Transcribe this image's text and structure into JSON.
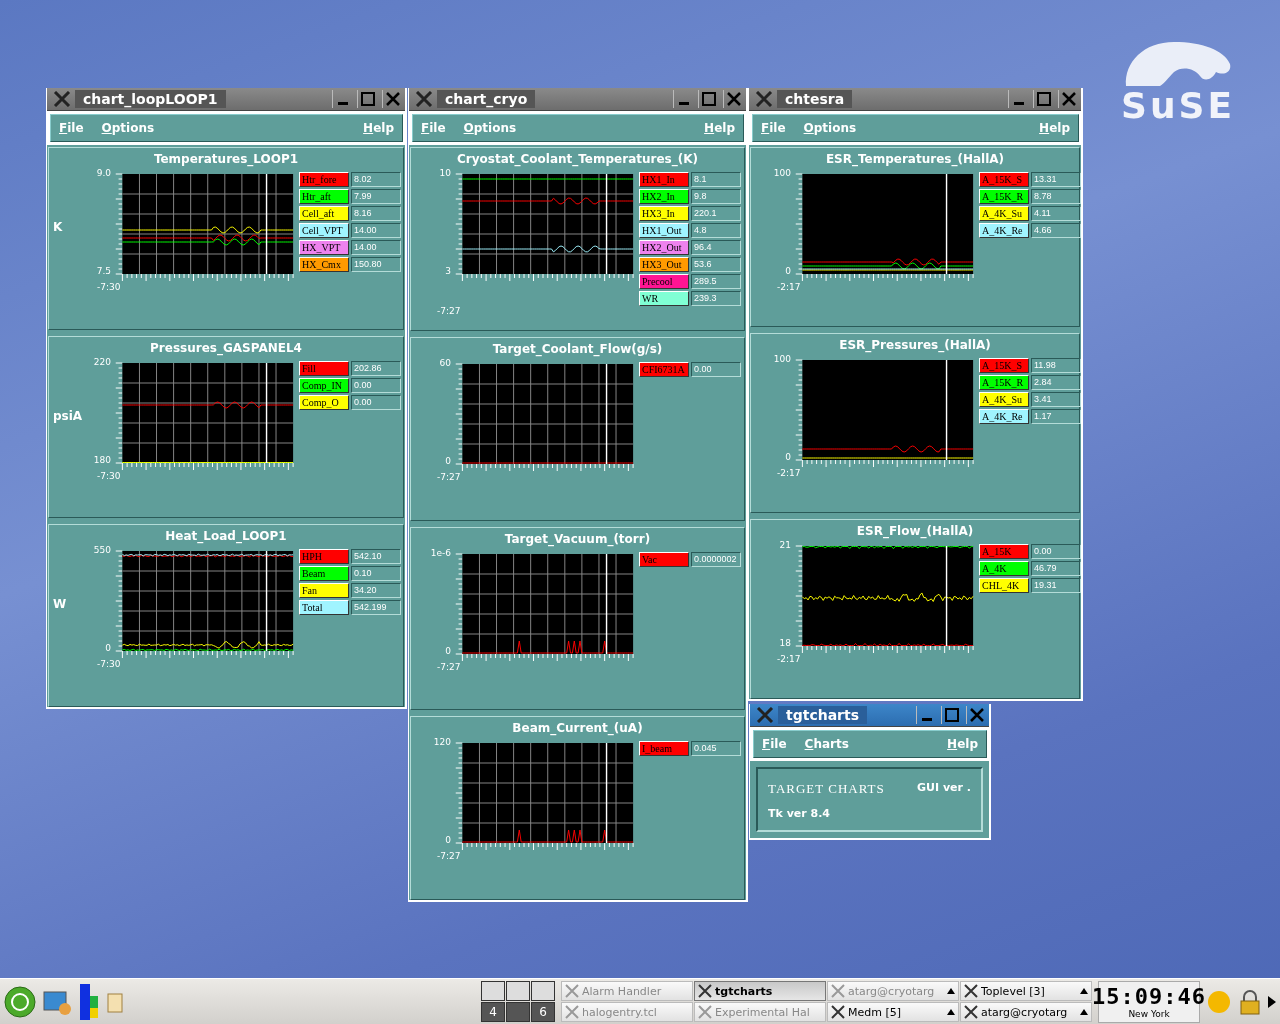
{
  "logo": {
    "text": "SuSE"
  },
  "windows": [
    {
      "kind": "charts",
      "title": "chart_loopLOOP1",
      "active": false,
      "menu": [
        "File",
        "Options",
        "Help"
      ],
      "panels": [
        {
          "title": "Temperatures_LOOP1",
          "unit": "K",
          "y_max": "9.0",
          "y_min": "7.5",
          "x_start": "-7:30",
          "legend": [
            {
              "name": "Htr_fore",
              "color": "#ff0000",
              "value": "8.02"
            },
            {
              "name": "Htr_aft",
              "color": "#00ff00",
              "value": "7.99"
            },
            {
              "name": "Cell_aft",
              "color": "#ffff00",
              "value": "8.16"
            },
            {
              "name": "Cell_VPT",
              "color": "#a0f4ff",
              "value": "14.00"
            },
            {
              "name": "HX_VPT",
              "color": "#ee82ee",
              "value": "14.00"
            },
            {
              "name": "HX_Cmx",
              "color": "#ff9a00",
              "value": "150.80"
            }
          ]
        },
        {
          "title": "Pressures_GASPANEL4",
          "unit": "psiA",
          "y_max": "220",
          "y_min": "180",
          "x_start": "-7:30",
          "legend": [
            {
              "name": "Fill",
              "color": "#ff0000",
              "value": "202.86"
            },
            {
              "name": "Comp_IN",
              "color": "#00ff00",
              "value": "0.00"
            },
            {
              "name": "Comp_O",
              "color": "#ffff00",
              "value": "0.00"
            }
          ]
        },
        {
          "title": "Heat_Load_LOOP1",
          "unit": "W",
          "y_max": "550",
          "y_min": "0",
          "x_start": "-7:30",
          "legend": [
            {
              "name": "HPH",
              "color": "#ff0000",
              "value": "542.10"
            },
            {
              "name": "Beam",
              "color": "#00ff00",
              "value": "0.10"
            },
            {
              "name": "Fan",
              "color": "#ffff00",
              "value": "34.20"
            },
            {
              "name": "Total",
              "color": "#a0f4ff",
              "value": "542.199"
            }
          ]
        }
      ]
    },
    {
      "kind": "charts",
      "title": "chart_cryo",
      "active": false,
      "menu": [
        "File",
        "Options",
        "Help"
      ],
      "panels": [
        {
          "title": "Cryostat_Coolant_Temperatures_(K)",
          "y_max": "10",
          "y_min": "3",
          "x_start": "-7:27",
          "legend": [
            {
              "name": "HX1_In",
              "color": "#ff0000",
              "value": "8.1"
            },
            {
              "name": "HX2_In",
              "color": "#00ff00",
              "value": "9.8"
            },
            {
              "name": "HX3_In",
              "color": "#ffff00",
              "value": "220.1"
            },
            {
              "name": "HX1_Out",
              "color": "#a0f4ff",
              "value": "4.8"
            },
            {
              "name": "HX2_Out",
              "color": "#ee82ee",
              "value": "96.4"
            },
            {
              "name": "HX3_Out",
              "color": "#ff9a00",
              "value": "53.6"
            },
            {
              "name": "Precool",
              "color": "#ff1493",
              "value": "289.5"
            },
            {
              "name": "WR",
              "color": "#80ffd4",
              "value": "239.3"
            }
          ]
        },
        {
          "title": "Target_Coolant_Flow(g/s)",
          "y_max": "60",
          "y_min": "0",
          "x_start": "-7:27",
          "legend": [
            {
              "name": "CFI6731A",
              "color": "#ff0000",
              "value": "0.00"
            }
          ]
        },
        {
          "title": "Target_Vacuum_(torr)",
          "y_max": "1e-6",
          "y_min": "0",
          "x_start": "-7:27",
          "legend": [
            {
              "name": "Vac",
              "color": "#ff0000",
              "value": "0.0000002"
            }
          ]
        },
        {
          "title": "Beam_Current_(uA)",
          "y_max": "120",
          "y_min": "0",
          "x_start": "-7:27",
          "legend": [
            {
              "name": "I_beam",
              "color": "#ff0000",
              "value": "0.045"
            }
          ]
        }
      ]
    },
    {
      "kind": "charts",
      "title": "chtesra",
      "active": false,
      "menu": [
        "File",
        "Options",
        "Help"
      ],
      "panels": [
        {
          "title": "ESR_Temperatures_(HallA)",
          "y_max": "100",
          "y_min": "0",
          "x_start": "-2:17",
          "legend": [
            {
              "name": "A_15K_S",
              "color": "#ff0000",
              "value": "13.31"
            },
            {
              "name": "A_15K_R",
              "color": "#00ff00",
              "value": "8.78"
            },
            {
              "name": "A_4K_Su",
              "color": "#ffff00",
              "value": "4.11"
            },
            {
              "name": "A_4K_Re",
              "color": "#a0f4ff",
              "value": "4.66"
            }
          ]
        },
        {
          "title": "ESR_Pressures_(HallA)",
          "y_max": "100",
          "y_min": "0",
          "x_start": "-2:17",
          "legend": [
            {
              "name": "A_15K_S",
              "color": "#ff0000",
              "value": "11.98"
            },
            {
              "name": "A_15K_R",
              "color": "#00ff00",
              "value": "2.84"
            },
            {
              "name": "A_4K_Su",
              "color": "#ffff00",
              "value": "3.41"
            },
            {
              "name": "A_4K_Re",
              "color": "#a0f4ff",
              "value": "1.17"
            }
          ]
        },
        {
          "title": "ESR_Flow_(HallA)",
          "y_max": "21",
          "y_min": "18",
          "x_start": "-2:17",
          "legend": [
            {
              "name": "A_15K",
              "color": "#ff0000",
              "value": "0.00"
            },
            {
              "name": "A_4K",
              "color": "#00ff00",
              "value": "46.79"
            },
            {
              "name": "CHL_4K",
              "color": "#ffff00",
              "value": "19.31"
            }
          ]
        }
      ]
    },
    {
      "kind": "about",
      "title": "tgtcharts",
      "active": true,
      "menu": [
        "File",
        "Charts",
        "Help"
      ],
      "heading": "TARGET CHARTS",
      "gui_version": "GUI ver .",
      "tk_version": "Tk ver 8.4"
    }
  ],
  "taskbar": {
    "pager": [
      "4",
      "6"
    ],
    "tasks": [
      {
        "label": "Alarm Handler",
        "selected": false,
        "minimized": true,
        "grouped": false
      },
      {
        "label": "tgtcharts",
        "selected": true,
        "minimized": false,
        "grouped": false
      },
      {
        "label": "atarg@cryotarg",
        "selected": false,
        "minimized": true,
        "grouped": true
      },
      {
        "label": "Toplevel [3]",
        "selected": false,
        "minimized": false,
        "grouped": true
      },
      {
        "label": "halogentry.tcl",
        "selected": false,
        "minimized": true,
        "grouped": false
      },
      {
        "label": "Experimental Hal",
        "selected": false,
        "minimized": true,
        "grouped": false
      },
      {
        "label": "Medm [5]",
        "selected": false,
        "minimized": false,
        "grouped": true
      },
      {
        "label": "atarg@cryotarg",
        "selected": false,
        "minimized": false,
        "grouped": true
      }
    ],
    "clock": {
      "time": "15:09:46",
      "zone": "New York"
    }
  }
}
